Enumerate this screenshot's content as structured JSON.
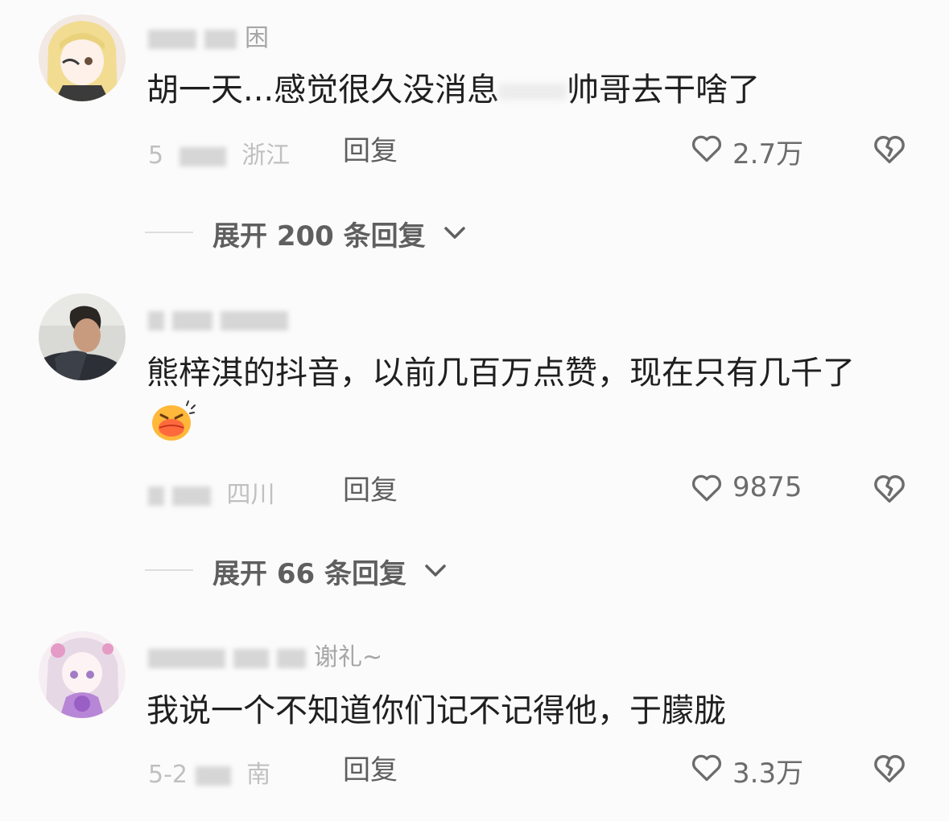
{
  "comments": [
    {
      "username": "困",
      "text_a": "胡一天...感觉很久没消息",
      "text_b": "帅哥去干啥了",
      "date": "5",
      "location": "浙江",
      "reply_label": "回复",
      "likes": "2.7万",
      "expand_label": "展开 200 条回复"
    },
    {
      "username": "",
      "text": "熊梓淇的抖音，以前几百万点赞，现在只有几千了",
      "date": "",
      "location": "四川",
      "reply_label": "回复",
      "likes": "9875",
      "expand_label": "展开 66 条回复"
    },
    {
      "username": "谢礼~",
      "text": "我说一个不知道你们记不记得他，于朦胧",
      "date": "5-2",
      "location": "南",
      "reply_label": "回复",
      "likes": "3.3万"
    }
  ],
  "icons": {
    "like": "heart-outline-icon",
    "dislike": "broken-heart-icon",
    "expand": "chevron-down-icon",
    "emoji": "kiss-emoji-icon"
  },
  "colors": {
    "background": "#fbfbfb",
    "text": "#1f1f1f",
    "secondary": "#6c6c6c",
    "muted": "#c0c0c0"
  }
}
